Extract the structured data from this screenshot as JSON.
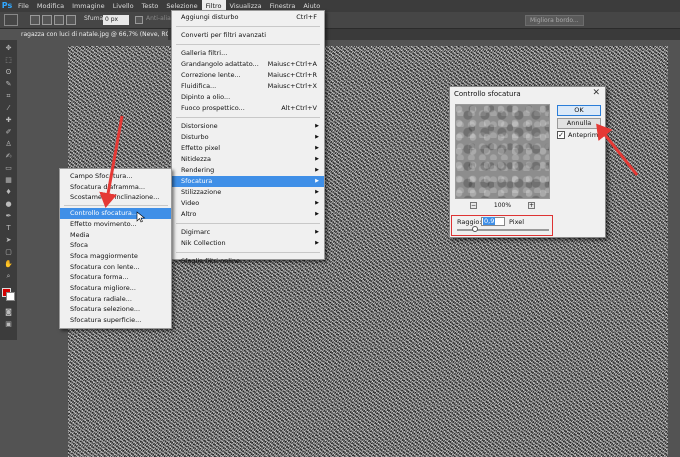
{
  "menubar": {
    "items": [
      "File",
      "Modifica",
      "Immagine",
      "Livello",
      "Testo",
      "Selezione",
      "Filtro",
      "Visualizza",
      "Finestra",
      "Aiuto"
    ],
    "active_index": 6
  },
  "options": {
    "feather_label": "Sfuma:",
    "feather_value": "0 px",
    "antialias_label": "Anti-alias",
    "refine_label": "Migliora bordo..."
  },
  "document": {
    "tab_title": "ragazza con luci di natale.jpg @ 66,7% (Neve, RGB/8) *"
  },
  "filter_menu": {
    "items": [
      {
        "label": "Aggiungi disturbo",
        "shortcut": "Ctrl+F"
      },
      {
        "label": "Converti per filtri avanzati"
      },
      {
        "label": "Galleria filtri..."
      },
      {
        "label": "Grandangolo adattato...",
        "shortcut": "Maiusc+Ctrl+A"
      },
      {
        "label": "Correzione lente...",
        "shortcut": "Maiusc+Ctrl+R"
      },
      {
        "label": "Fluidifica...",
        "shortcut": "Maiusc+Ctrl+X"
      },
      {
        "label": "Dipinto a olio..."
      },
      {
        "label": "Fuoco prospettico...",
        "shortcut": "Alt+Ctrl+V"
      },
      {
        "label": "Distorsione"
      },
      {
        "label": "Disturbo"
      },
      {
        "label": "Effetto pixel"
      },
      {
        "label": "Nitidezza"
      },
      {
        "label": "Rendering"
      },
      {
        "label": "Sfocatura"
      },
      {
        "label": "Stilizzazione"
      },
      {
        "label": "Video"
      },
      {
        "label": "Altro"
      },
      {
        "label": "Digimarc"
      },
      {
        "label": "Nik Collection"
      },
      {
        "label": "Sfoglia filtri online..."
      }
    ],
    "highlighted_index": 13
  },
  "blur_submenu": {
    "items": [
      "Campo Sfocatura...",
      "Sfocatura diaframma...",
      "Scostamento inclinazione...",
      "Controllo sfocatura...",
      "Effetto movimento...",
      "Media",
      "Sfoca",
      "Sfoca maggiormente",
      "Sfocatura con lente...",
      "Sfocatura forma...",
      "Sfocatura migliore...",
      "Sfocatura radiale...",
      "Sfocatura selezione...",
      "Sfocatura superficie..."
    ],
    "highlighted_index": 3
  },
  "dialog": {
    "title": "Controllo sfocatura",
    "close": "✕",
    "ok_label": "OK",
    "cancel_label": "Annulla",
    "preview_label": "Anteprima",
    "preview_checked": true,
    "zoom": "100%",
    "zoom_minus": "−",
    "zoom_plus": "+",
    "radius_label": "Raggio:",
    "radius_value": "0,9",
    "radius_unit": "Pixel"
  },
  "colors": {
    "foreground": "#d40000",
    "background": "#ffffff",
    "highlight": "#3f8fe7",
    "annotation": "#e53935"
  }
}
